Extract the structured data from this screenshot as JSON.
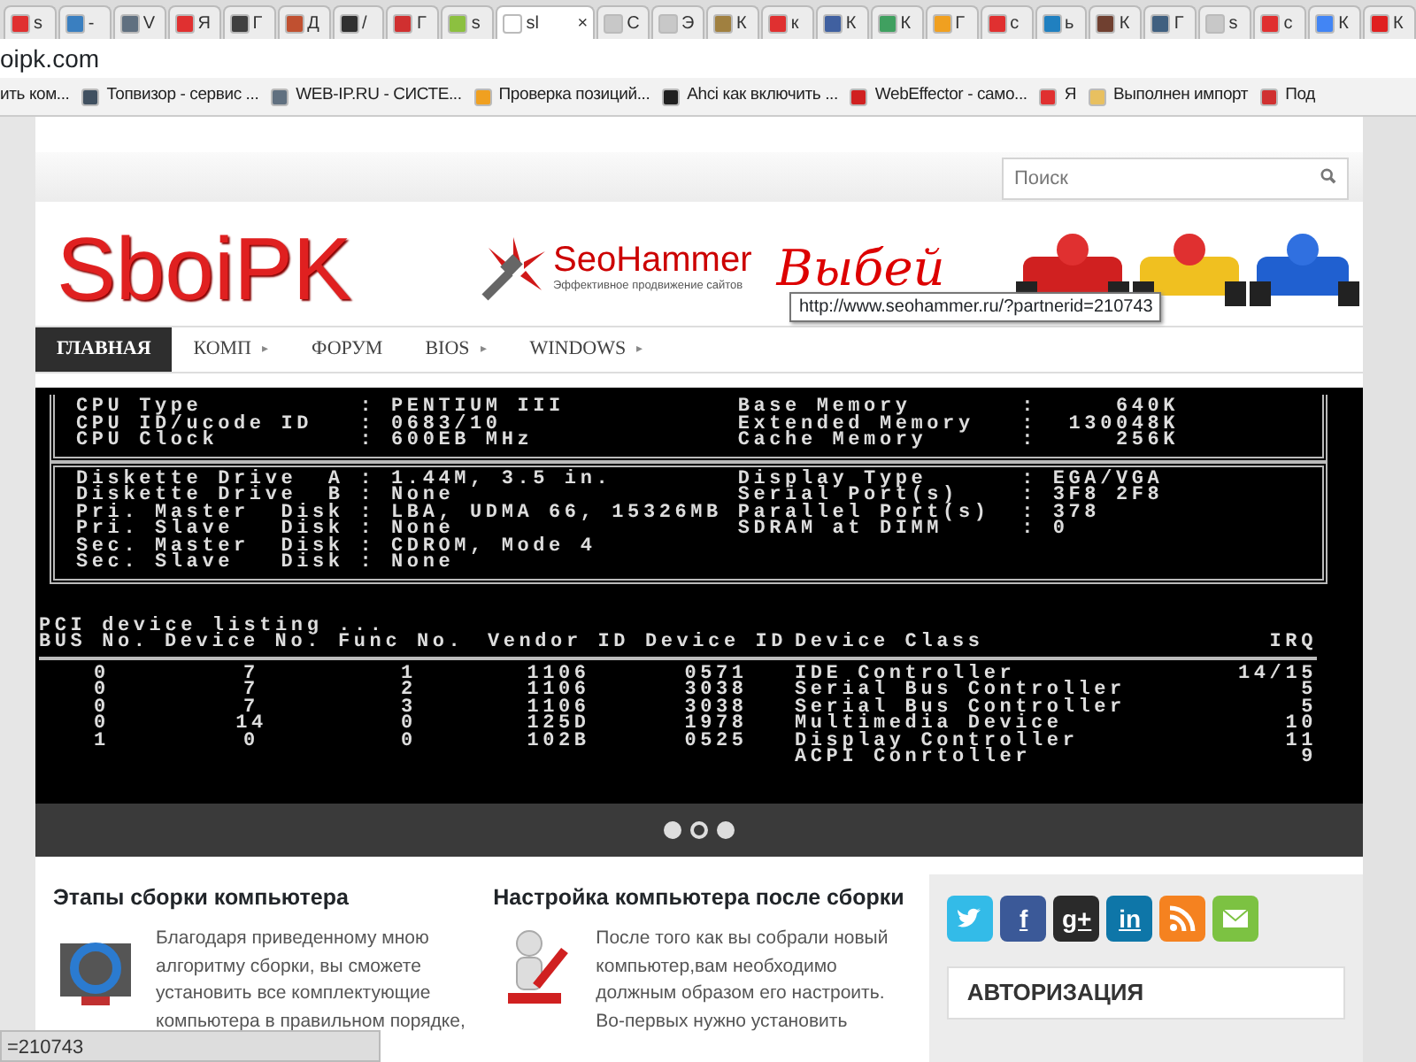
{
  "browser": {
    "tabs": [
      {
        "label": "s",
        "color": "#e03030",
        "selected": false
      },
      {
        "label": "-",
        "color": "#3a7fc0",
        "selected": false
      },
      {
        "label": "V",
        "color": "#607080",
        "selected": false
      },
      {
        "label": "Я",
        "color": "#e03030",
        "selected": false
      },
      {
        "label": "Г",
        "color": "#404040",
        "selected": false
      },
      {
        "label": "Д",
        "color": "#c05030",
        "selected": false
      },
      {
        "label": "/",
        "color": "#303030",
        "selected": false
      },
      {
        "label": "Г",
        "color": "#d03030",
        "selected": false
      },
      {
        "label": "s",
        "color": "#8cc040",
        "selected": false
      },
      {
        "label": "sl",
        "color": "#ffffff",
        "selected": true
      },
      {
        "label": "С",
        "color": "#c8c8c8",
        "selected": false
      },
      {
        "label": "Э",
        "color": "#c8c8c8",
        "selected": false
      },
      {
        "label": "К",
        "color": "#a08040",
        "selected": false
      },
      {
        "label": "к",
        "color": "#e03030",
        "selected": false
      },
      {
        "label": "К",
        "color": "#4060a0",
        "selected": false
      },
      {
        "label": "К",
        "color": "#40a060",
        "selected": false
      },
      {
        "label": "Г",
        "color": "#f0a020",
        "selected": false
      },
      {
        "label": "с",
        "color": "#e03030",
        "selected": false
      },
      {
        "label": "ь",
        "color": "#2080c0",
        "selected": false
      },
      {
        "label": "К",
        "color": "#704030",
        "selected": false
      },
      {
        "label": "Г",
        "color": "#406080",
        "selected": false
      },
      {
        "label": "s",
        "color": "#c8c8c8",
        "selected": false
      },
      {
        "label": "с",
        "color": "#e03030",
        "selected": false
      },
      {
        "label": "К",
        "color": "#4285f4",
        "selected": false
      },
      {
        "label": "К",
        "color": "#e02020",
        "selected": false
      }
    ],
    "close_label": "×",
    "address": "oipk.com",
    "bookmarks": [
      {
        "label": "ить ком..."
      },
      {
        "label": "Топвизор - сервис ...",
        "color": "#405060"
      },
      {
        "label": "WEB-IP.RU - СИСТЕ...",
        "color": "#607080"
      },
      {
        "label": "Проверка позиций...",
        "color": "#f0a020"
      },
      {
        "label": "Ahci как включить ...",
        "color": "#202020"
      },
      {
        "label": "WebEffector - само...",
        "color": "#d02020"
      },
      {
        "label": "Я",
        "color": "#e03030"
      },
      {
        "label": "Выполнен импорт",
        "color": "#e8c060"
      },
      {
        "label": "Под",
        "color": "#d03030"
      }
    ]
  },
  "site": {
    "search": {
      "placeholder": "Поиск"
    },
    "logo": "SboiPK",
    "banner": {
      "brand": "SeoHammer",
      "tagline": "Эффективное продвижение сайтов",
      "slogan": "Выбей",
      "tooltip": "http://www.seohammer.ru/?partnerid=210743"
    },
    "nav": [
      {
        "label": "ГЛАВНАЯ",
        "selected": true,
        "submenu": false
      },
      {
        "label": "КОМП",
        "selected": false,
        "submenu": true
      },
      {
        "label": "ФОРУМ",
        "selected": false,
        "submenu": false
      },
      {
        "label": "BIOS",
        "selected": false,
        "submenu": true
      },
      {
        "label": "WINDOWS",
        "selected": false,
        "submenu": true
      }
    ],
    "submenu_marker": "▸",
    "bios": {
      "box_1": [
        "CPU Type          : PENTIUM III           Base Memory       :     640K",
        "CPU ID/ucode ID   : 0683/10               Extended Memory   :  130048K",
        "CPU Clock         : 600EB MHz             Cache Memory      :     256K"
      ],
      "box_2": [
        "Diskette Drive  A : 1.44M, 3.5 in.        Display Type      : EGA/VGA",
        "Diskette Drive  B : None                  Serial Port(s)    : 3F8 2F8",
        "Pri. Master  Disk : LBA, UDMA 66, 15326MB Parallel Port(s)  : 378",
        "Pri. Slave   Disk : None                  SDRAM at DIMM     : 0",
        "Sec. Master  Disk : CDROM, Mode 4",
        "Sec. Slave   Disk : None"
      ],
      "pci_heading": "PCI device listing ...",
      "pci_columns": [
        "BUS No.",
        "Device No.",
        "Func No.",
        "Vendor ID",
        "Device ID",
        "Device Class",
        "IRQ"
      ],
      "pci_rows": [
        {
          "bus": "0",
          "device": "7",
          "func": "1",
          "vendor": "1106",
          "device_id": "0571",
          "class": "IDE Controller",
          "irq": "14/15"
        },
        {
          "bus": "0",
          "device": "7",
          "func": "2",
          "vendor": "1106",
          "device_id": "3038",
          "class": "Serial Bus Controller",
          "irq": "5"
        },
        {
          "bus": "0",
          "device": "7",
          "func": "3",
          "vendor": "1106",
          "device_id": "3038",
          "class": "Serial Bus Controller",
          "irq": "5"
        },
        {
          "bus": "0",
          "device": "14",
          "func": "0",
          "vendor": "125D",
          "device_id": "1978",
          "class": "Multimedia Device",
          "irq": "10"
        },
        {
          "bus": "1",
          "device": "0",
          "func": "0",
          "vendor": "102B",
          "device_id": "0525",
          "class": "Display Controller",
          "irq": "11"
        },
        {
          "class": "ACPI Conrtoller",
          "irq": "9"
        }
      ]
    },
    "carousel": [
      {
        "selected": false
      },
      {
        "selected": true
      },
      {
        "selected": false
      }
    ],
    "articles": [
      {
        "title": "Этапы сборки компьютера",
        "kind": "monitor",
        "text": "Благодаря приведенному мною алгоритму сборки, вы сможете установить все комплектующие компьютера в правильном порядке,"
      },
      {
        "title": "Настройка компьютера после сборки",
        "kind": "wrench",
        "text": "После того как вы собрали новый компьютер,вам необходимо должным образом его настроить. Во-первых нужно установить"
      }
    ],
    "social": [
      {
        "kind": "twitter",
        "color": "#33bbe8"
      },
      {
        "kind": "facebook",
        "label": "f",
        "color": "#3b5998"
      },
      {
        "kind": "google",
        "label": "g+",
        "color": "#2a2a2a"
      },
      {
        "kind": "linkedin",
        "label": "in",
        "color": "#0e76a8"
      },
      {
        "kind": "rss",
        "color": "#f58220"
      },
      {
        "kind": "mail",
        "color": "#7cc242"
      }
    ],
    "auth_heading": "АВТОРИЗАЦИЯ"
  },
  "status_bar": "=210743"
}
